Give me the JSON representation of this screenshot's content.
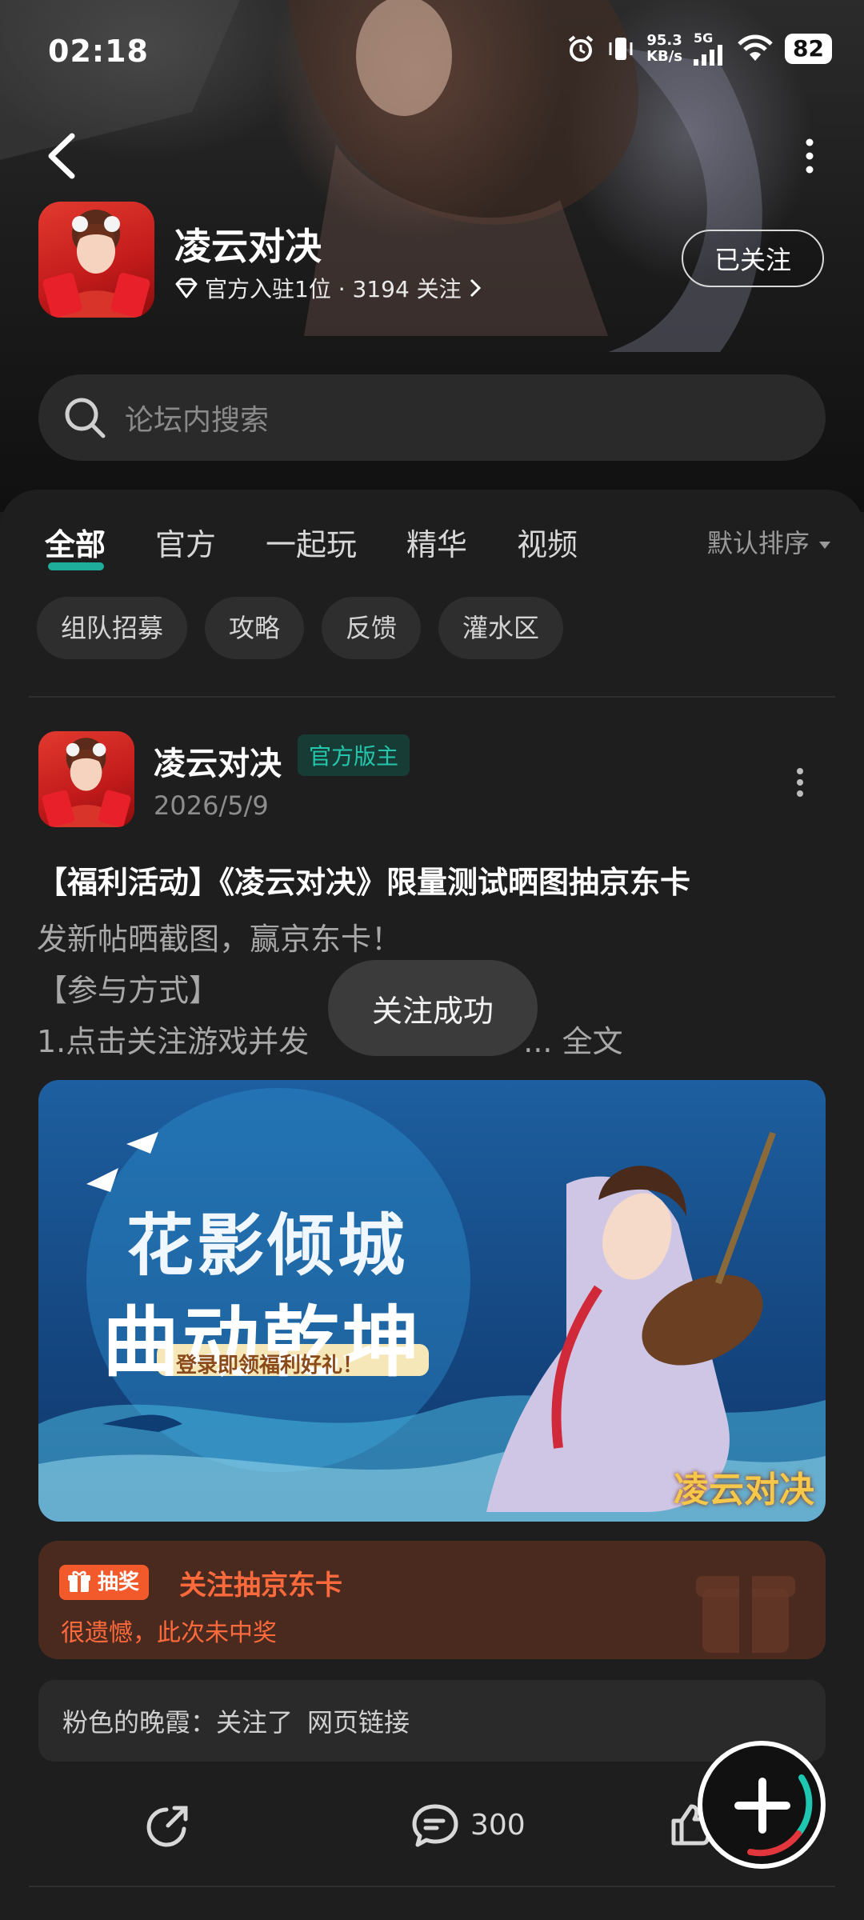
{
  "status_bar": {
    "time": "02:18",
    "net_speed_value": "95.3",
    "net_speed_unit": "KB/s",
    "network": "5G",
    "battery": "82"
  },
  "header": {
    "game_name": "凌云对决",
    "meta_text": "官方入驻1位 · 3194 关注",
    "follow_label": "已关注"
  },
  "search": {
    "placeholder": "论坛内搜索"
  },
  "tabs": [
    {
      "label": "全部",
      "active": true
    },
    {
      "label": "官方"
    },
    {
      "label": "一起玩"
    },
    {
      "label": "精华"
    },
    {
      "label": "视频"
    }
  ],
  "sort_label": "默认排序",
  "chips": [
    "组队招募",
    "攻略",
    "反馈",
    "灌水区"
  ],
  "post": {
    "author": "凌云对决",
    "badge": "官方版主",
    "date": "2026/5/9",
    "title": "【福利活动】《凌云对决》限量测试晒图抽京东卡",
    "body_line1": "发新帖晒截图，赢京东卡！",
    "body_line2": "【参与方式】",
    "body_line3": "1.点击关注游戏并发",
    "body_ellipsis": "...",
    "full_text": "全文",
    "banner_title1": "花影倾城",
    "banner_title2": "曲动乾坤",
    "banner_ribbon": "登录即领福利好礼！",
    "banner_logo": "凌云对决",
    "lottery_tag": "抽奖",
    "lottery_title": "关注抽京东卡",
    "lottery_result": "很遗憾，此次未中奖",
    "comment_user": "粉色的晚霞：关注了",
    "comment_link": "网页链接",
    "comment_count": "300"
  },
  "toast": "关注成功",
  "colors": {
    "accent": "#1fc7b2",
    "lottery_orange": "#ff6a3c",
    "bg": "#1e1e1e"
  }
}
